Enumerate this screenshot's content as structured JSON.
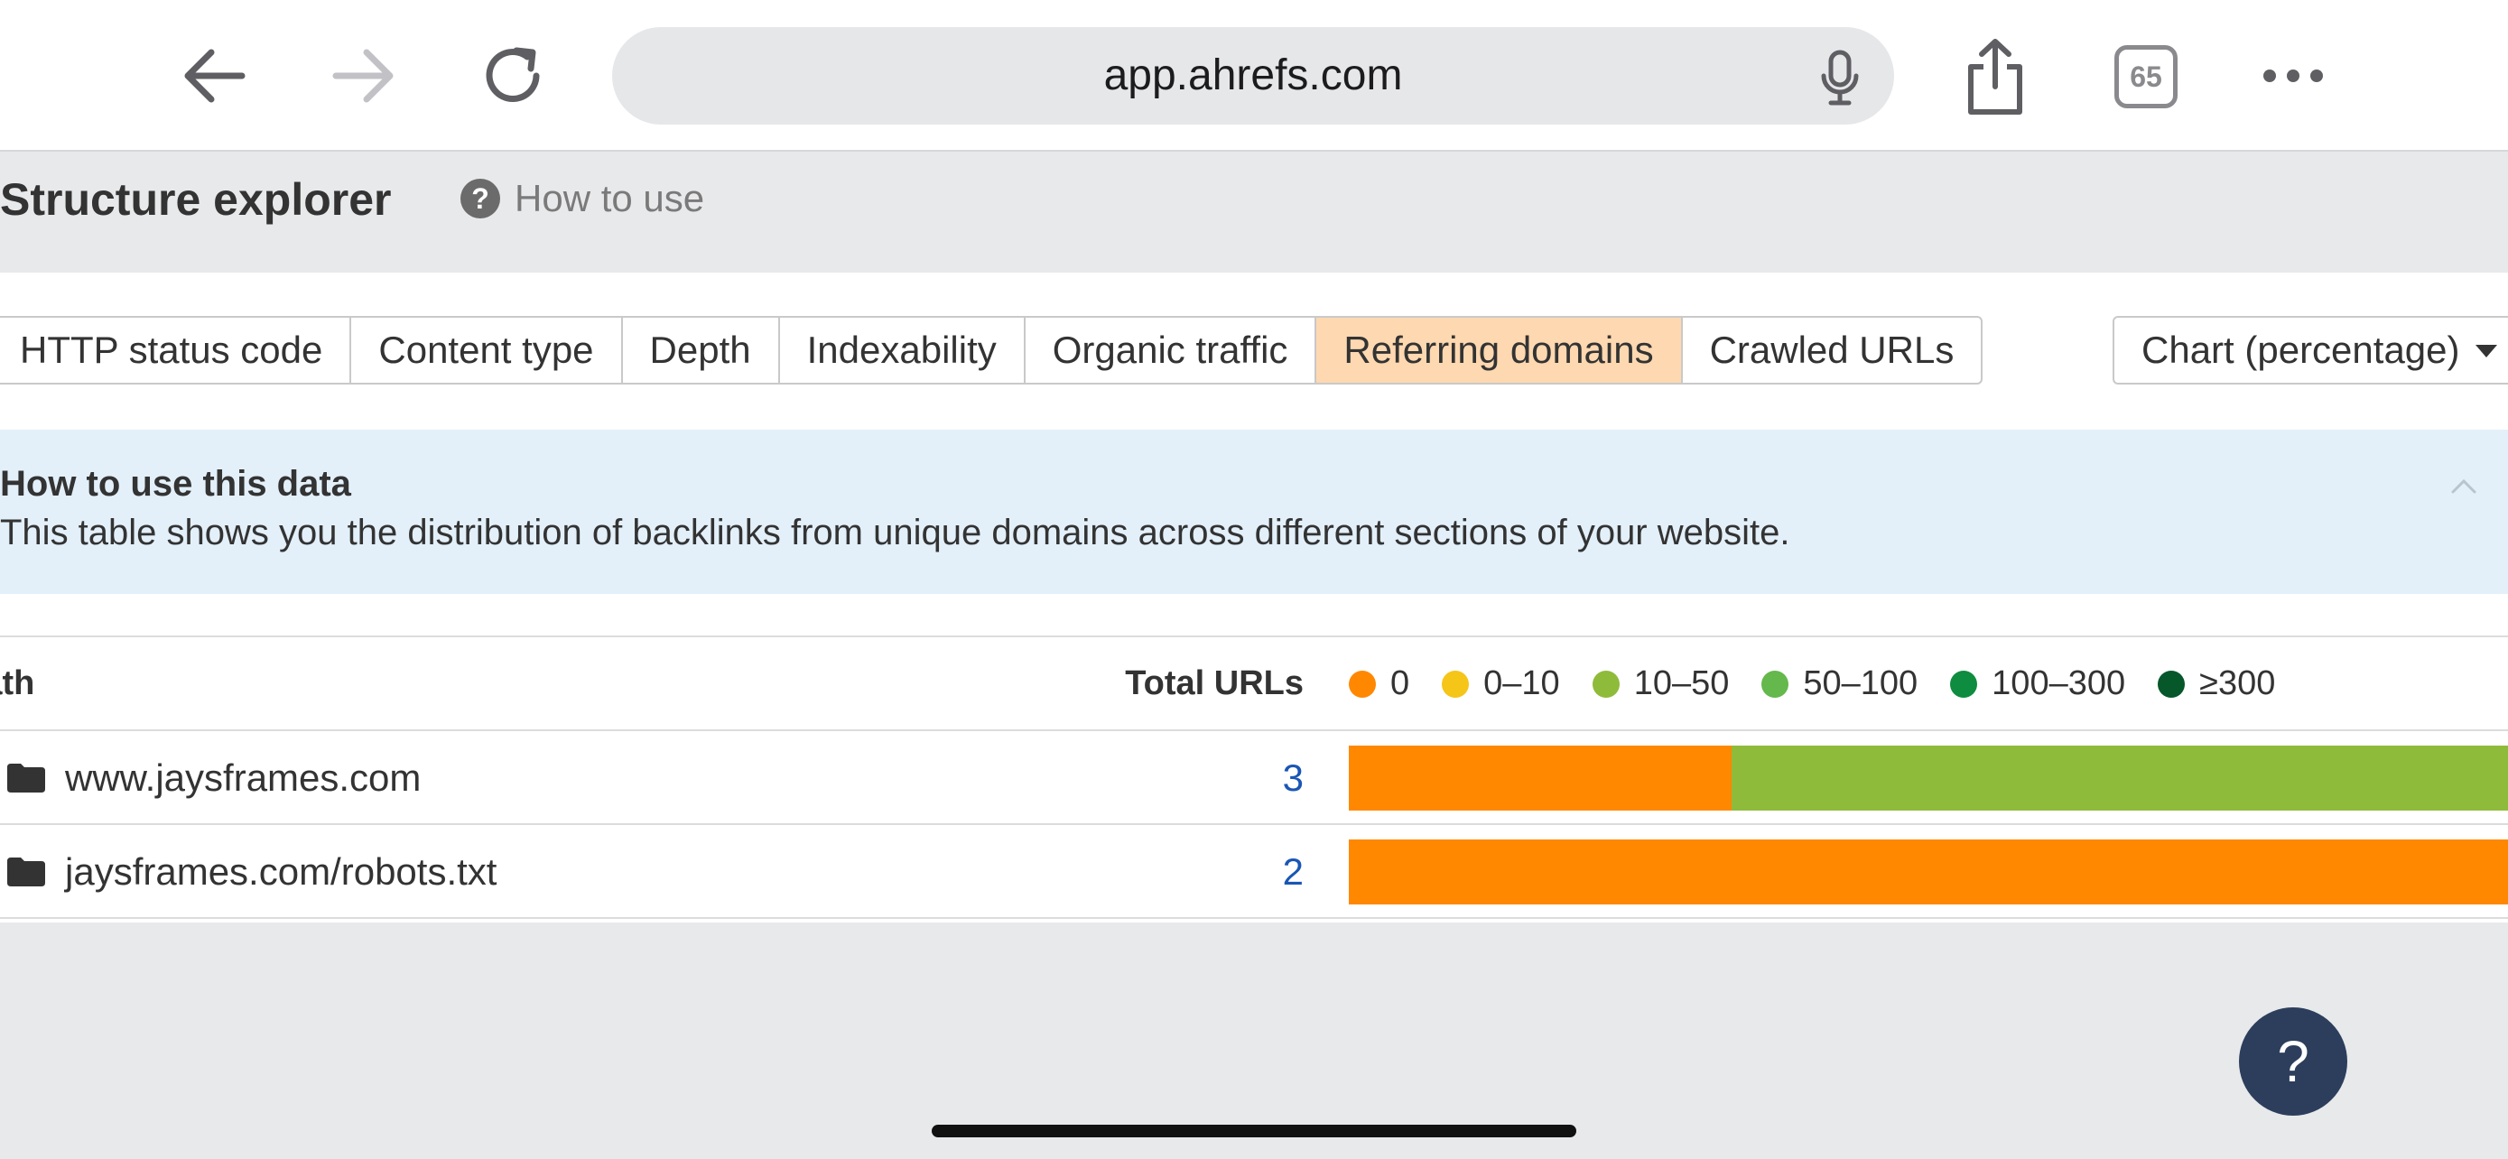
{
  "browser": {
    "url": "app.ahrefs.com",
    "tab_count": "65"
  },
  "header": {
    "title": "Structure explorer",
    "help_label": "How to use",
    "help_icon_glyph": "?"
  },
  "tabs": [
    {
      "label": "HTTP status code",
      "active": false
    },
    {
      "label": "Content type",
      "active": false
    },
    {
      "label": "Depth",
      "active": false
    },
    {
      "label": "Indexability",
      "active": false
    },
    {
      "label": "Organic traffic",
      "active": false
    },
    {
      "label": "Referring domains",
      "active": true
    },
    {
      "label": "Crawled URLs",
      "active": false
    }
  ],
  "view_select": {
    "value": "Chart (percentage)"
  },
  "info": {
    "title": "How to use this data",
    "text": "This table shows you the distribution of backlinks from unique domains across different sections of your website."
  },
  "table": {
    "col_path": "Path",
    "col_total": "Total URLs",
    "legend": [
      {
        "label": "0",
        "color": "#ff8800"
      },
      {
        "label": "0–10",
        "color": "#f5c518"
      },
      {
        "label": "10–50",
        "color": "#8fbb3a"
      },
      {
        "label": "50–100",
        "color": "#64b84c"
      },
      {
        "label": "100–300",
        "color": "#0e8c3f"
      },
      {
        "label": "≥300",
        "color": "#06572a"
      }
    ],
    "rows": [
      {
        "path": "www.jaysframes.com",
        "total": "3",
        "distribution": [
          {
            "bucket": "0",
            "fraction": 0.33,
            "color": "#ff8800"
          },
          {
            "bucket": "10–50",
            "fraction": 0.67,
            "color": "#8fbb3a"
          }
        ]
      },
      {
        "path": "jaysframes.com/robots.txt",
        "total": "2",
        "distribution": [
          {
            "bucket": "0",
            "fraction": 1.0,
            "color": "#ff8800"
          }
        ]
      }
    ]
  },
  "help_fab": {
    "glyph": "?"
  }
}
